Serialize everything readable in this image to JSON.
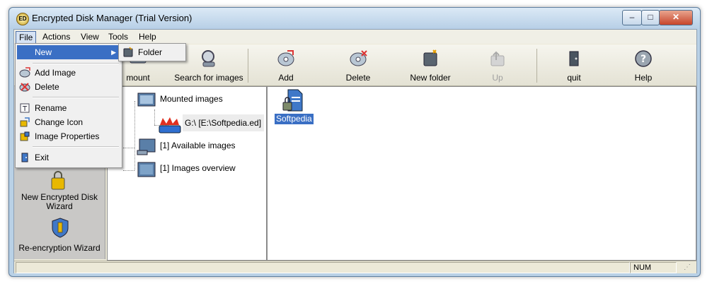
{
  "window": {
    "title": "Encrypted Disk Manager (Trial Version)",
    "title_icon": "ED"
  },
  "window_buttons": {
    "minimize": "–",
    "maximize": "□",
    "close": "✕"
  },
  "menubar": {
    "file": "File",
    "actions": "Actions",
    "view": "View",
    "tools": "Tools",
    "help": "Help"
  },
  "toolbar": {
    "mount": "mount",
    "search": "Search for images",
    "add": "Add",
    "delete": "Delete",
    "new_folder": "New folder",
    "up": "Up",
    "quit": "quit",
    "help": "Help"
  },
  "wizards": {
    "new_disk": "New Encrypted Disk Wizard",
    "reencrypt": "Re-encryption Wizard"
  },
  "tree": {
    "mounted": "Mounted images",
    "mounted_child": "G:\\ [E:\\Softpedia.ed]",
    "available": "[1] Available images",
    "overview": "[1] Images overview"
  },
  "files": {
    "item1": "Softpedia"
  },
  "status": {
    "num": "NUM"
  },
  "file_menu": {
    "new": "New",
    "add_image": "Add Image",
    "delete": "Delete",
    "rename": "Rename",
    "change_icon": "Change Icon",
    "image_properties": "Image Properties",
    "exit": "Exit"
  },
  "submenu": {
    "folder": "Folder"
  },
  "colors": {
    "highlight": "#3a6fc4",
    "menu_bg": "#f0f0f0",
    "client_bg": "#ece9d8"
  }
}
